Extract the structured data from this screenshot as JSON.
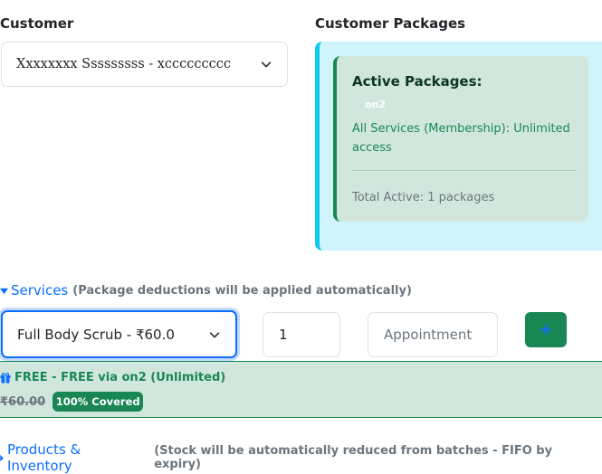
{
  "customer": {
    "label": "Customer",
    "selected": "Xxxxxxxx Sssssssss - xccccccccc"
  },
  "packages": {
    "label": "Customer Packages",
    "active_title": "Active Packages:",
    "package_code": "on2",
    "service_line": "All Services (Membership): Unlimited access",
    "total": "Total Active: 1 packages"
  },
  "services": {
    "title": "Services",
    "note": "(Package deductions will be applied automatically)",
    "selected_service": "Full Body Scrub - ₹60.0",
    "quantity": "1",
    "appointment_placeholder": "Appointment",
    "add_label": "+",
    "free_text": "FREE - FREE via on2 (Unlimited)",
    "old_price": "₹60.00",
    "badge": "100% Covered"
  },
  "products": {
    "title": "Products & Inventory",
    "note": "(Stock will be automatically reduced from batches - FIFO by expiry)"
  },
  "colors": {
    "accent": "#0d6efd",
    "success": "#198754",
    "info": "#0dcaf0"
  }
}
